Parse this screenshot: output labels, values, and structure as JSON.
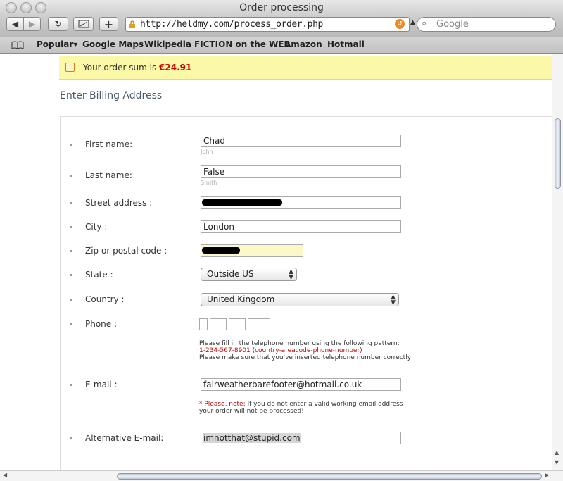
{
  "window": {
    "title": "Order processing"
  },
  "toolbar": {
    "url": "http://heldmy.com/process_order.php",
    "search_placeholder": "Google"
  },
  "bookmarks": [
    "Popular▾",
    "Google Maps",
    "Wikipedia",
    "FICTION on the WEB",
    "Amazon",
    "Hotmail"
  ],
  "notice": {
    "prefix": "Your order sum is ",
    "sum": "€24.91"
  },
  "form": {
    "title": "Enter Billing Address",
    "labels": {
      "first_name": "First name:",
      "last_name": "Last name:",
      "street": "Street address :",
      "city": "City :",
      "zip": "Zip or postal code :",
      "state": "State :",
      "country": "Country :",
      "phone": "Phone :",
      "email": "E-mail :",
      "alt_email": "Alternative E-mail:"
    },
    "values": {
      "first_name": "Chad",
      "last_name": "False",
      "city": "London",
      "state": "Outside US",
      "country": "United Kingdom",
      "email": "fairweatherbarefooter@hotmail.co.uk",
      "alt_email": "imnotthat@stupid.com"
    },
    "hints": {
      "first_name": "John",
      "last_name": "Smith"
    },
    "phone_help": {
      "line1": "Please fill in the telephone number using the following pattern:",
      "pattern": "1-234-567-8901 (country-areacode-phone-number)",
      "line3": "Please make sure that you've inserted telephone number correctly"
    },
    "email_note": {
      "label": "* Please, note:",
      "text": " If you do not enter a valid working email address",
      "line2": "your order will not be processed!"
    }
  }
}
